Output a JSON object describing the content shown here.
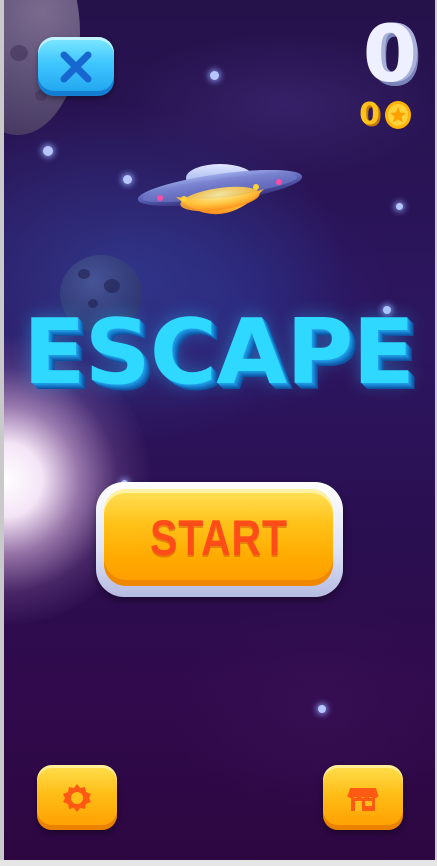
{
  "game": {
    "title": "ESCAPE",
    "score": "0",
    "coins": "0"
  },
  "buttons": {
    "start_label": "START"
  },
  "icons": {
    "close": "close-icon",
    "coin": "coin-icon",
    "settings": "gear-icon",
    "shop": "shop-icon",
    "ufo": "ufo-icon"
  },
  "colors": {
    "title": "#2ed8ff",
    "start_button": "#ffc21a",
    "start_text": "#ff4d1a",
    "close_button": "#3fc6ff",
    "background": "#2a1457"
  }
}
